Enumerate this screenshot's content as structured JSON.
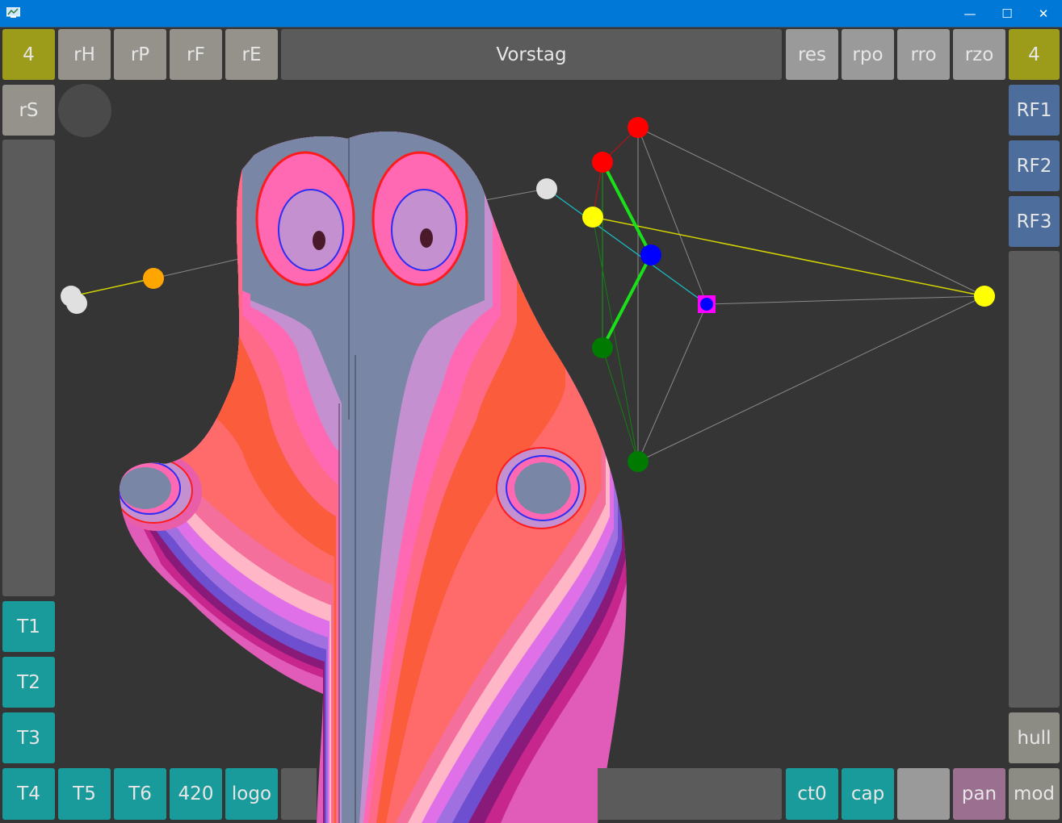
{
  "top_bar": {
    "left_count": "4",
    "rH": "rH",
    "rP": "rP",
    "rF": "rF",
    "rE": "rE",
    "title": "Vorstag",
    "res": "res",
    "rpo": "rpo",
    "rro": "rro",
    "rzo": "rzo",
    "right_count": "4"
  },
  "left_column": {
    "rS": "rS",
    "T1": "T1",
    "T2": "T2",
    "T3": "T3",
    "T4": "T4"
  },
  "right_column": {
    "RF1": "RF1",
    "RF2": "RF2",
    "RF3": "RF3",
    "hull": "hull"
  },
  "bottom_bar": {
    "T5": "T5",
    "T6": "T6",
    "v420": "420",
    "logo": "logo",
    "ct0": "ct0",
    "cap": "cap",
    "pan": "pan",
    "mod": "mod"
  },
  "colors": {
    "accent_olive": "#9d9b1a",
    "teal": "#1a9b9b",
    "blue": "#4d6d9d",
    "background": "#353535"
  }
}
